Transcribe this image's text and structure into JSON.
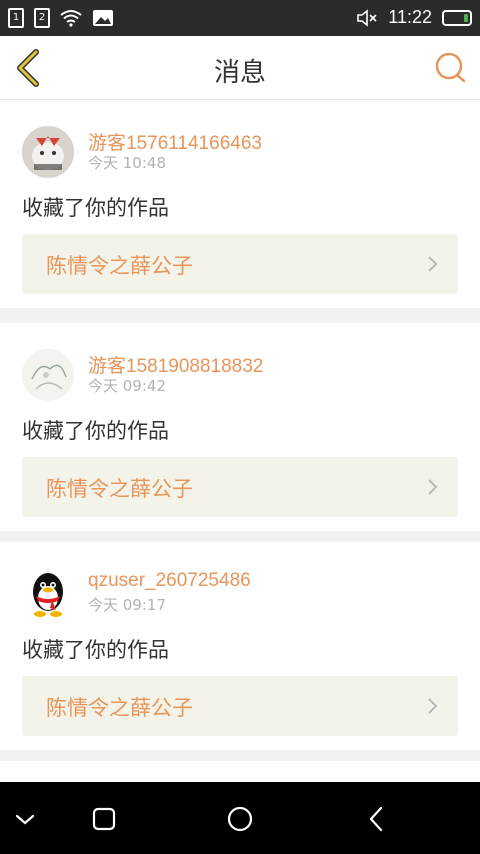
{
  "status_bar": {
    "time": "11:22",
    "sim1": "1",
    "sim2": "2"
  },
  "nav": {
    "title": "消息"
  },
  "messages": [
    {
      "username": "游客1576114166463",
      "time": "今天 10:48",
      "action": "收藏了你的作品",
      "work_title": "陈情令之薛公子"
    },
    {
      "username": "游客1581908818832",
      "time": "今天 09:42",
      "action": "收藏了你的作品",
      "work_title": "陈情令之薛公子"
    },
    {
      "username": "qzuser_260725486",
      "time": "今天 09:17",
      "action": "收藏了你的作品",
      "work_title": "陈情令之薛公子"
    }
  ],
  "colors": {
    "accent": "#e8955a",
    "back_icon": "#e8c43a",
    "status_bar": "#2b2b2b"
  }
}
